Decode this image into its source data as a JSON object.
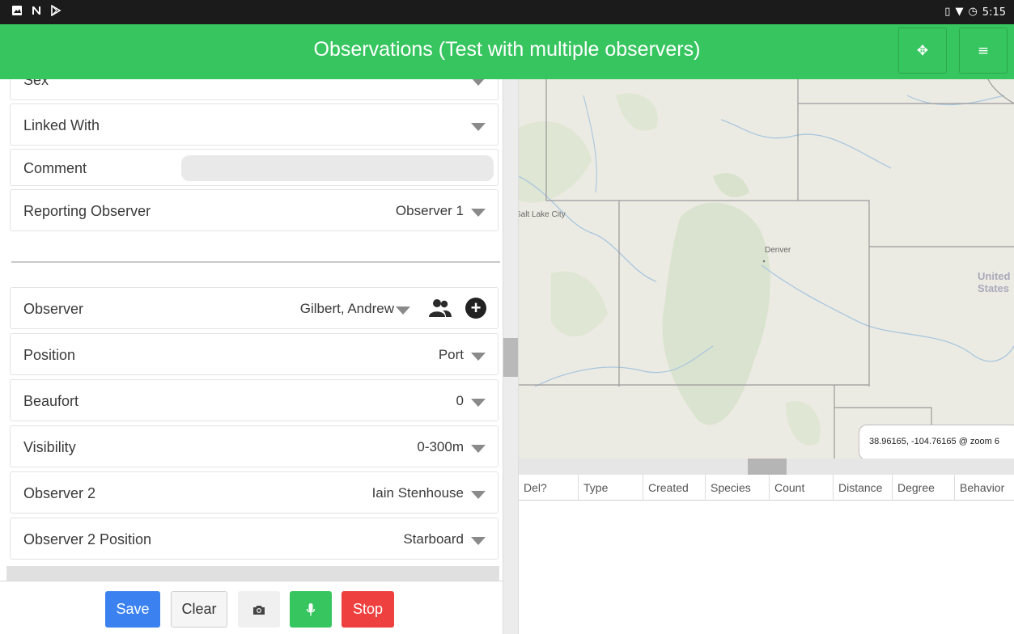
{
  "status_bar": {
    "left_icons": [
      "image-icon",
      "n-icon",
      "play-store-icon"
    ],
    "right_icons": [
      "vibrate-icon",
      "wifi-icon",
      "alarm-icon"
    ],
    "time": "5:15"
  },
  "app_bar": {
    "title": "Observations (Test with multiple observers)",
    "buttons": [
      "move-icon",
      "menu-icon"
    ],
    "color": "#37c55f"
  },
  "form": {
    "sex": {
      "label": "Sex"
    },
    "linked_with": {
      "label": "Linked With",
      "value": ""
    },
    "comment": {
      "label": "Comment",
      "value": ""
    },
    "reporting_observer": {
      "label": "Reporting Observer",
      "value": "Observer 1"
    },
    "observer": {
      "label": "Observer",
      "value": "Gilbert, Andrew"
    },
    "position": {
      "label": "Position",
      "value": "Port"
    },
    "beaufort": {
      "label": "Beaufort",
      "value": "0"
    },
    "visibility": {
      "label": "Visibility",
      "value": "0-300m"
    },
    "observer2": {
      "label": "Observer 2",
      "value": "Iain Stenhouse"
    },
    "observer2_position": {
      "label": "Observer 2 Position",
      "value": "Starboard"
    }
  },
  "actions": {
    "save": "Save",
    "clear": "Clear",
    "camera": "camera-icon",
    "mic": "microphone-icon",
    "stop": "Stop",
    "colors": {
      "save": "#3b82f0",
      "mic": "#37c55f",
      "stop": "#ef4040"
    }
  },
  "map": {
    "labels": {
      "salt_lake_city": "Salt Lake City",
      "denver": "Denver",
      "united_states": "United\nStates"
    },
    "coordinates": "38.96165, -104.76165 @ zoom 6"
  },
  "table": {
    "columns": [
      "Del?",
      "Type",
      "Created",
      "Species",
      "Count",
      "Distance",
      "Degree",
      "Behavior"
    ]
  }
}
